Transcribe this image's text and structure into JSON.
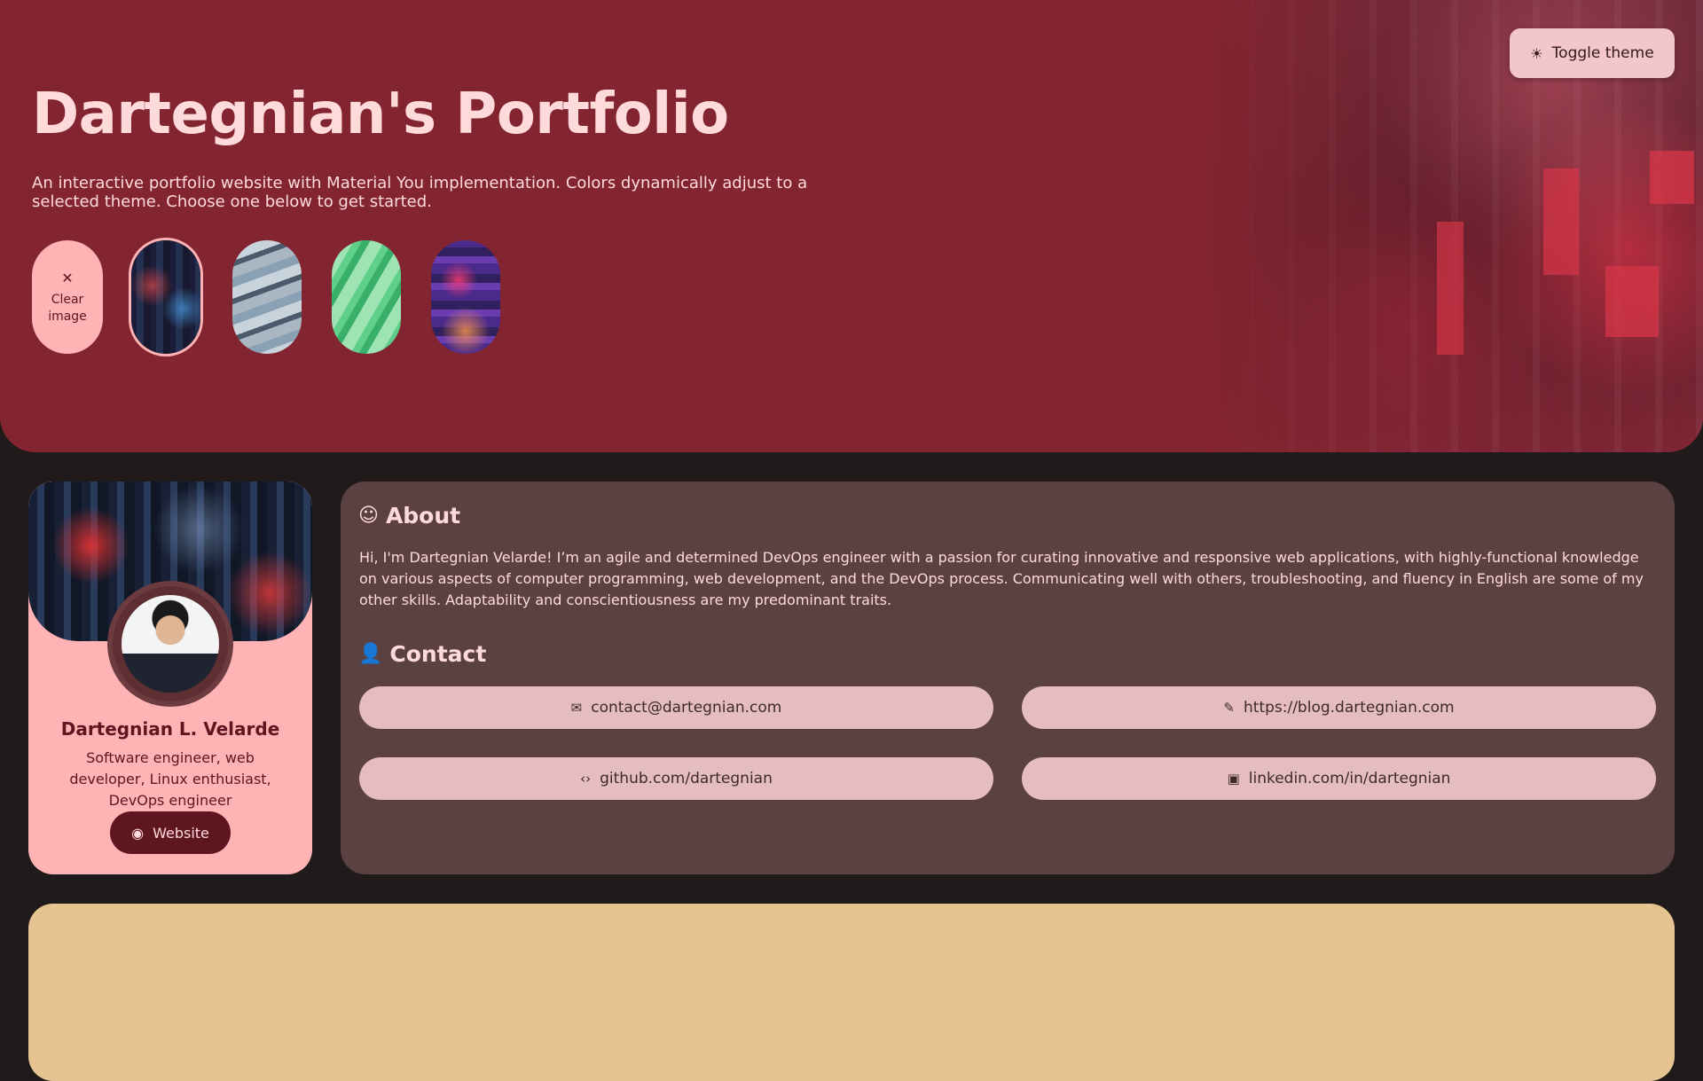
{
  "header": {
    "title": "Dartegnian's Portfolio",
    "description": "An interactive portfolio website with Material You implementation. Colors dynamically adjust to a selected theme. Choose one below to get started.",
    "toggle_label": "Toggle theme",
    "toggle_icon": "sun-icon"
  },
  "themes": {
    "clear_line1": "Clear",
    "clear_line2": "image",
    "clear_icon": "close-icon",
    "selected_index": 1
  },
  "profile": {
    "name": "Dartegnian L. Velarde",
    "role": "Software engineer, web developer, Linux enthusiast, DevOps engineer",
    "website_label": "Website",
    "website_icon": "globe-icon"
  },
  "about": {
    "heading": "About",
    "icon": "face-icon",
    "text": "Hi, I'm Dartegnian Velarde! I’m an agile and determined DevOps engineer with a passion for curating innovative and responsive web applications, with highly-functional knowledge on various aspects of computer programming, web development, and the DevOps process. Communicating well with others, troubleshooting, and fluency in English are some of my other skills. Adaptability and conscientiousness are my predominant traits."
  },
  "contact": {
    "heading": "Contact",
    "icon": "person-add-icon",
    "email": "contact@dartegnian.com",
    "blog": "https://blog.dartegnian.com",
    "github": "github.com/dartegnian",
    "linkedin": "linkedin.com/in/dartegnian"
  },
  "colors": {
    "hero_bg": "#832530",
    "page_bg": "#201a1a",
    "profile_card": "#ffb3b5",
    "about_card": "#5c4143",
    "contact_button": "#e6bdbe",
    "accent_dark": "#5e1620",
    "bottom_card": "#e5c491"
  }
}
